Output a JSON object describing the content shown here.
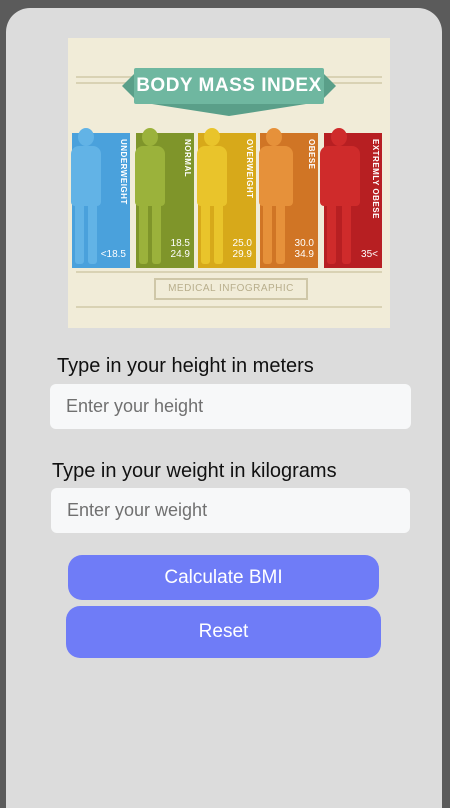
{
  "infographic": {
    "title": "BODY MASS INDEX",
    "footer": "MEDICAL INFOGRAPHIC",
    "categories": [
      {
        "label": "UNDERWEIGHT",
        "range": "<18.5",
        "color": "#62b3e6",
        "bar_color": "#4aa1dc"
      },
      {
        "label": "NORMAL",
        "range": "18.5\n24.9",
        "color": "#9bb23b",
        "bar_color": "#7f952a"
      },
      {
        "label": "OVERWEIGHT",
        "range": "25.0\n29.9",
        "color": "#e9c42b",
        "bar_color": "#d7a91a"
      },
      {
        "label": "OBESE",
        "range": "30.0\n34.9",
        "color": "#e6913a",
        "bar_color": "#d07525"
      },
      {
        "label": "EXTREMLY OBESE",
        "range": "35<",
        "color": "#cf2b2b",
        "bar_color": "#b71f22"
      }
    ]
  },
  "form": {
    "height_label": "Type in your height in meters",
    "height_placeholder": "Enter your height",
    "weight_label": "Type in your weight in kilograms",
    "weight_placeholder": "Enter your weight",
    "calculate_label": "Calculate BMI",
    "reset_label": "Reset"
  },
  "colors": {
    "button": "#6f7cf7",
    "card_background": "#dcdcdc",
    "outer_background": "#5b5b5b"
  }
}
